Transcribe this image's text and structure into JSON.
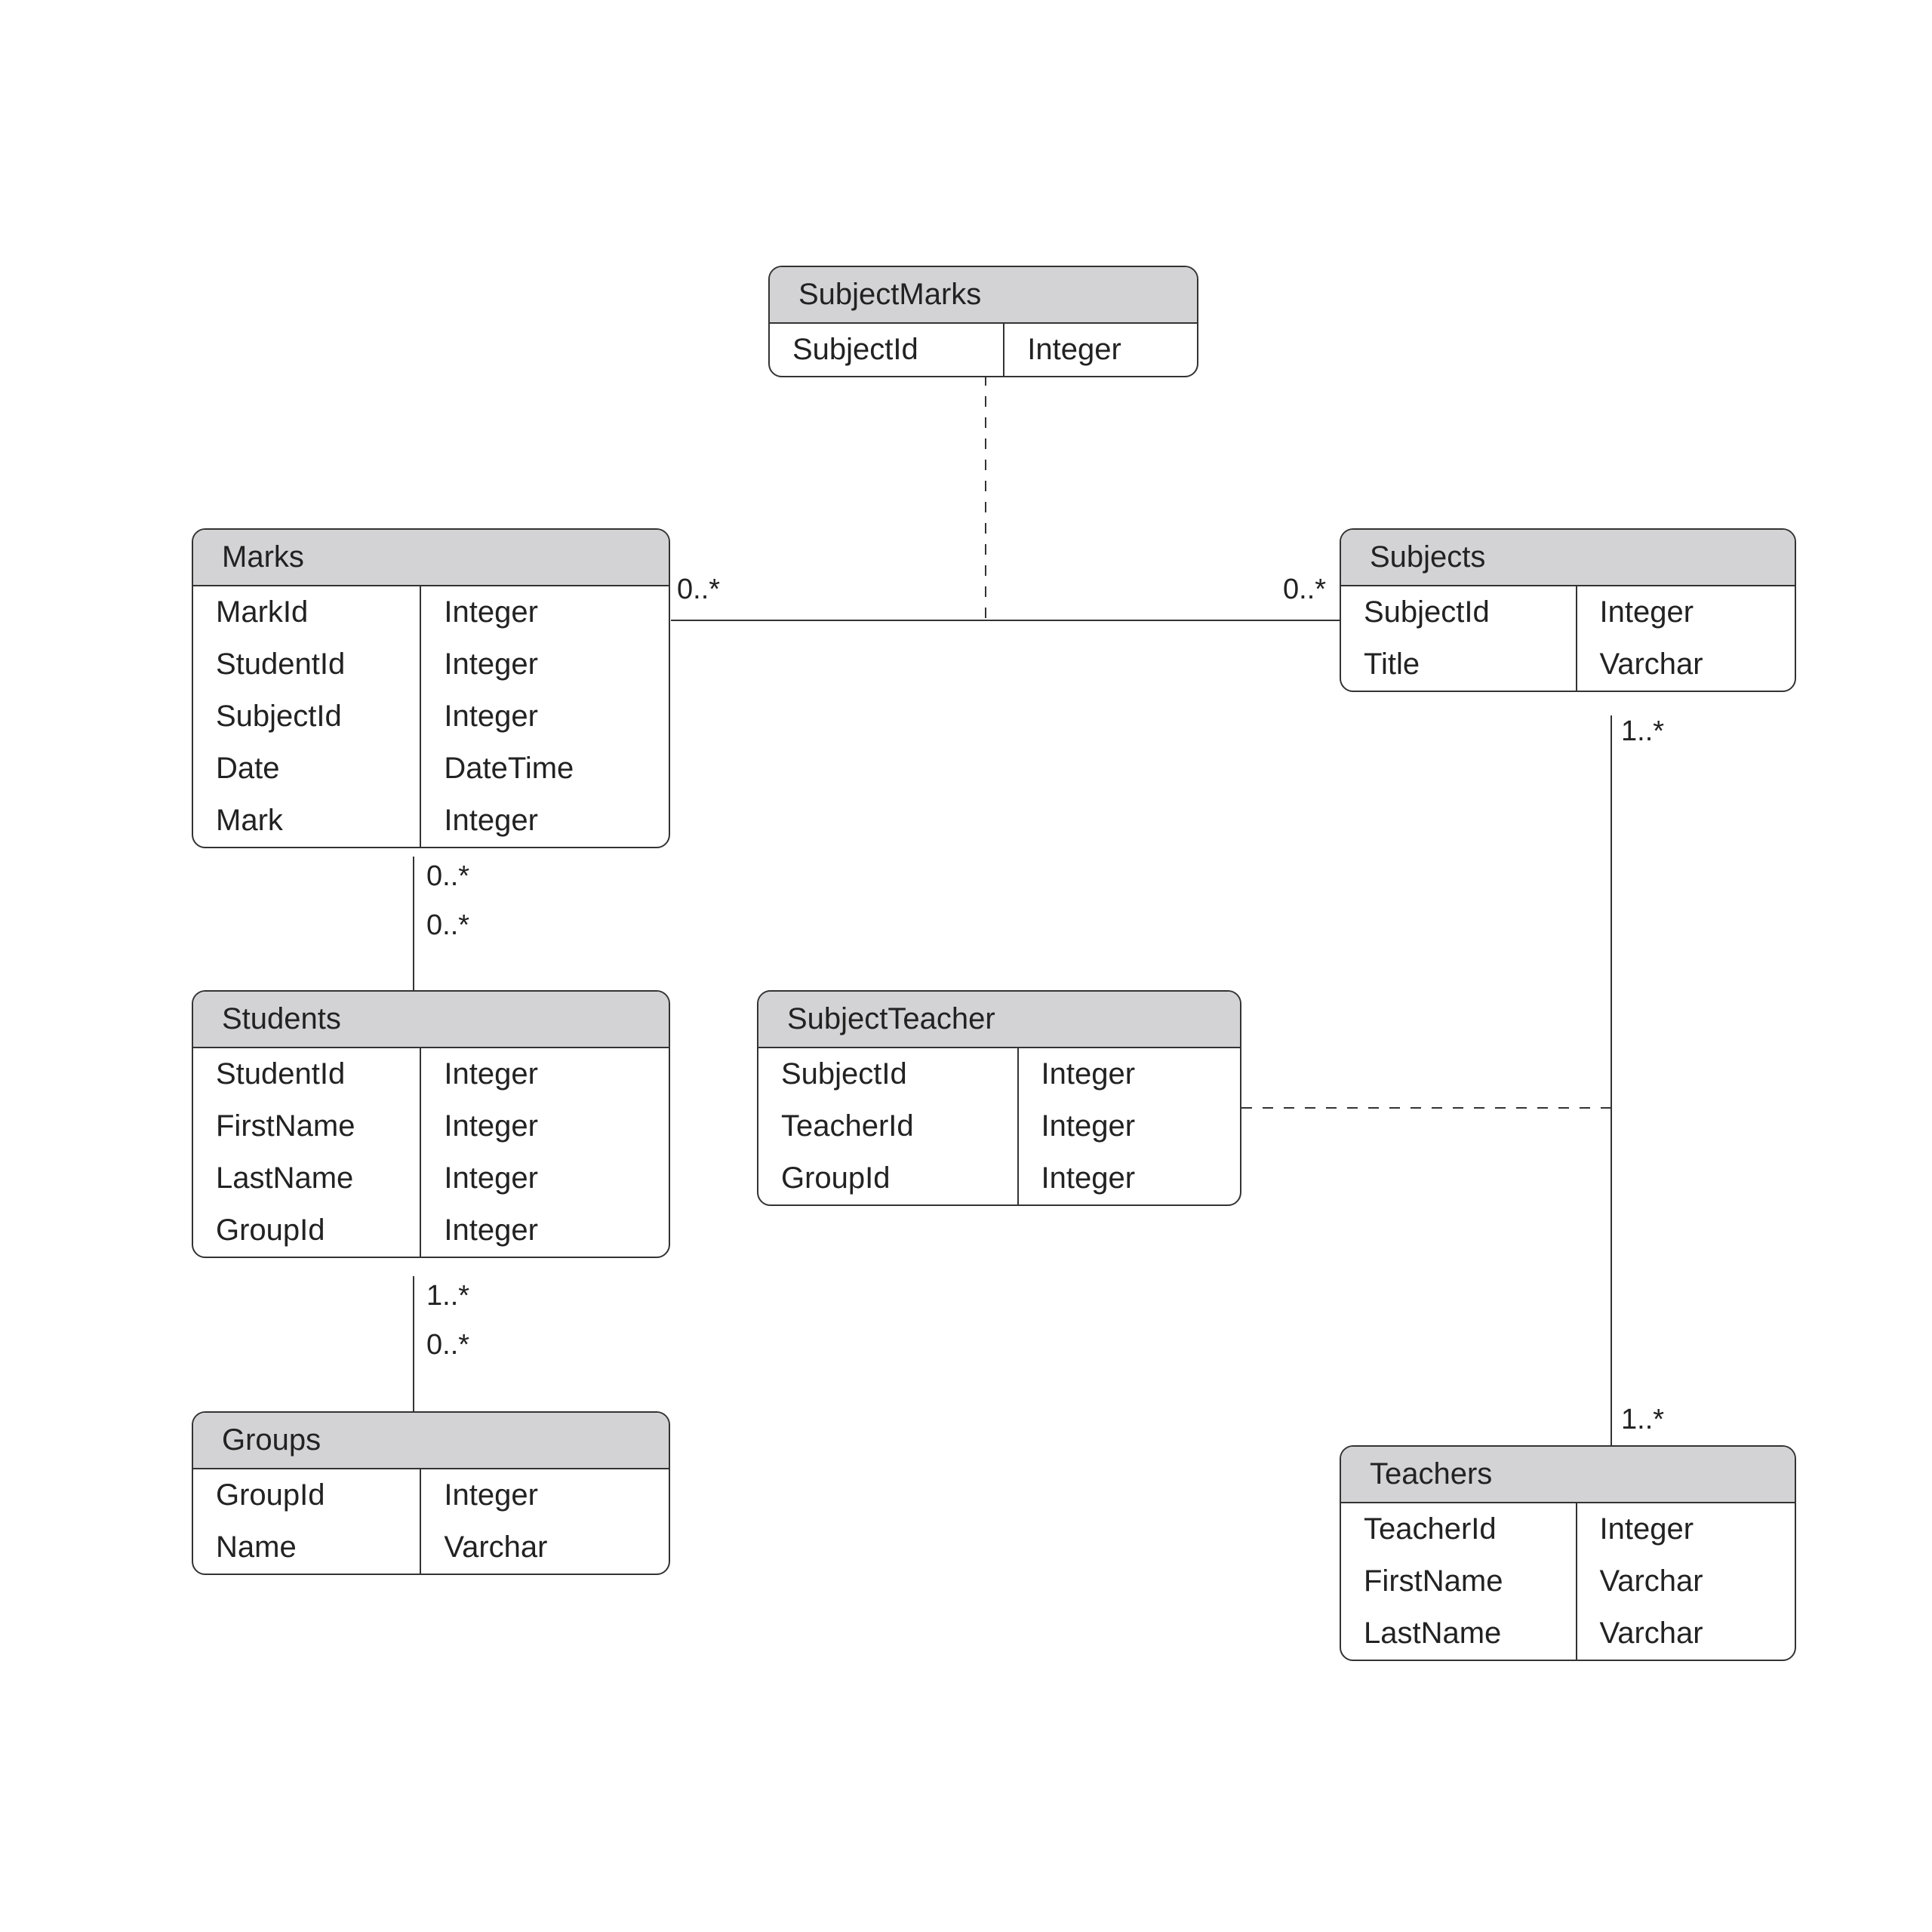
{
  "entities": {
    "subjectMarks": {
      "title": "SubjectMarks",
      "cols": [
        [
          "SubjectId"
        ],
        [
          "Integer"
        ]
      ]
    },
    "marks": {
      "title": "Marks",
      "cols": [
        [
          "MarkId",
          "StudentId",
          "SubjectId",
          "Date",
          "Mark"
        ],
        [
          "Integer",
          "Integer",
          "Integer",
          "DateTime",
          "Integer"
        ]
      ]
    },
    "subjects": {
      "title": "Subjects",
      "cols": [
        [
          "SubjectId",
          "Title"
        ],
        [
          "Integer",
          "Varchar"
        ]
      ]
    },
    "students": {
      "title": "Students",
      "cols": [
        [
          "StudentId",
          "FirstName",
          "LastName",
          "GroupId"
        ],
        [
          "Integer",
          "Integer",
          "Integer",
          "Integer"
        ]
      ]
    },
    "subjectTeacher": {
      "title": "SubjectTeacher",
      "cols": [
        [
          "SubjectId",
          "TeacherId",
          "GroupId"
        ],
        [
          "Integer",
          "Integer",
          "Integer"
        ]
      ]
    },
    "groups": {
      "title": "Groups",
      "cols": [
        [
          "GroupId",
          "Name"
        ],
        [
          "Integer",
          "Varchar"
        ]
      ]
    },
    "teachers": {
      "title": "Teachers",
      "cols": [
        [
          "TeacherId",
          "FirstName",
          "LastName"
        ],
        [
          "Integer",
          "Varchar",
          "Varchar"
        ]
      ]
    }
  },
  "multiplicities": {
    "marks_subjects_left": "0..*",
    "marks_subjects_right": "0..*",
    "marks_students_top": "0..*",
    "marks_students_bottom": "0..*",
    "students_groups_top": "1..*",
    "students_groups_bottom": "0..*",
    "subjects_teachers_top": "1..*",
    "subjects_teachers_bottom": "1..*"
  }
}
